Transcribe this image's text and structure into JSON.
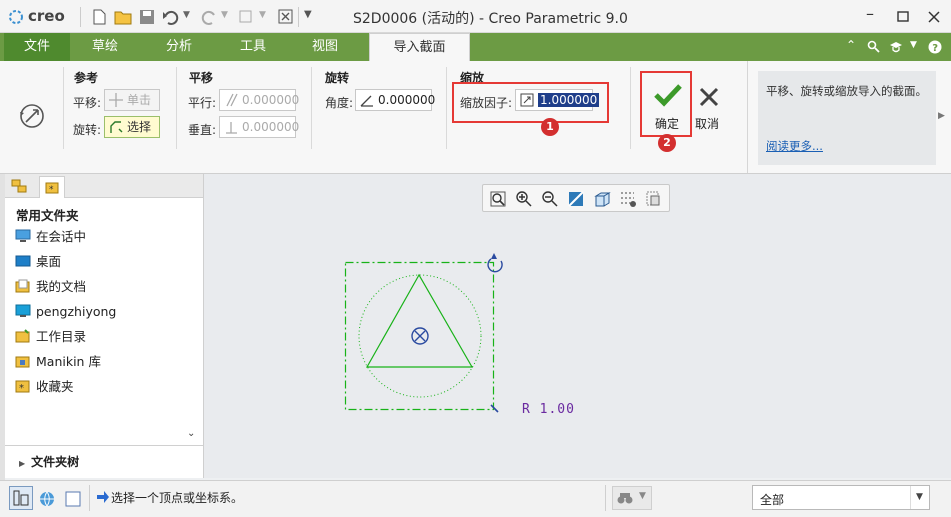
{
  "titlebar": {
    "logo": "creo",
    "title": "S2D0006 (活动的) - Creo Parametric 9.0"
  },
  "tabs": [
    {
      "label": "文件"
    },
    {
      "label": "草绘"
    },
    {
      "label": "分析"
    },
    {
      "label": "工具"
    },
    {
      "label": "视图"
    },
    {
      "label": "导入截面"
    }
  ],
  "ribbon": {
    "ref": {
      "title": "参考",
      "translate_label": "平移:",
      "translate_value": "单击",
      "rotate_label": "旋转:",
      "rotate_value": "选择"
    },
    "move": {
      "title": "平移",
      "parallel_label": "平行:",
      "parallel_value": "0.000000",
      "perp_label": "垂直:",
      "perp_value": "0.000000"
    },
    "rotate": {
      "title": "旋转",
      "angle_label": "角度:",
      "angle_value": "0.000000"
    },
    "scale": {
      "title": "缩放",
      "factor_label": "缩放因子:",
      "factor_value": "1.000000"
    },
    "ok_label": "确定",
    "cancel_label": "取消",
    "help_text": "平移、旋转或缩放导入的截面。",
    "help_link": "阅读更多...",
    "badge1": "1",
    "badge2": "2"
  },
  "folders": {
    "heading": "常用文件夹",
    "items": [
      "在会话中",
      "桌面",
      "我的文档",
      "pengzhiyong",
      "工作目录",
      "Manikin 库",
      "收藏夹"
    ],
    "tree_label": "文件夹树"
  },
  "canvas": {
    "dim_text": "R 1.00"
  },
  "status": {
    "message": "选择一个顶点或坐标系。",
    "filter_value": "全部"
  },
  "colors": {
    "green_tab": "#6c9b44",
    "sketch_green": "#18b218",
    "highlight_red": "#e53935"
  }
}
